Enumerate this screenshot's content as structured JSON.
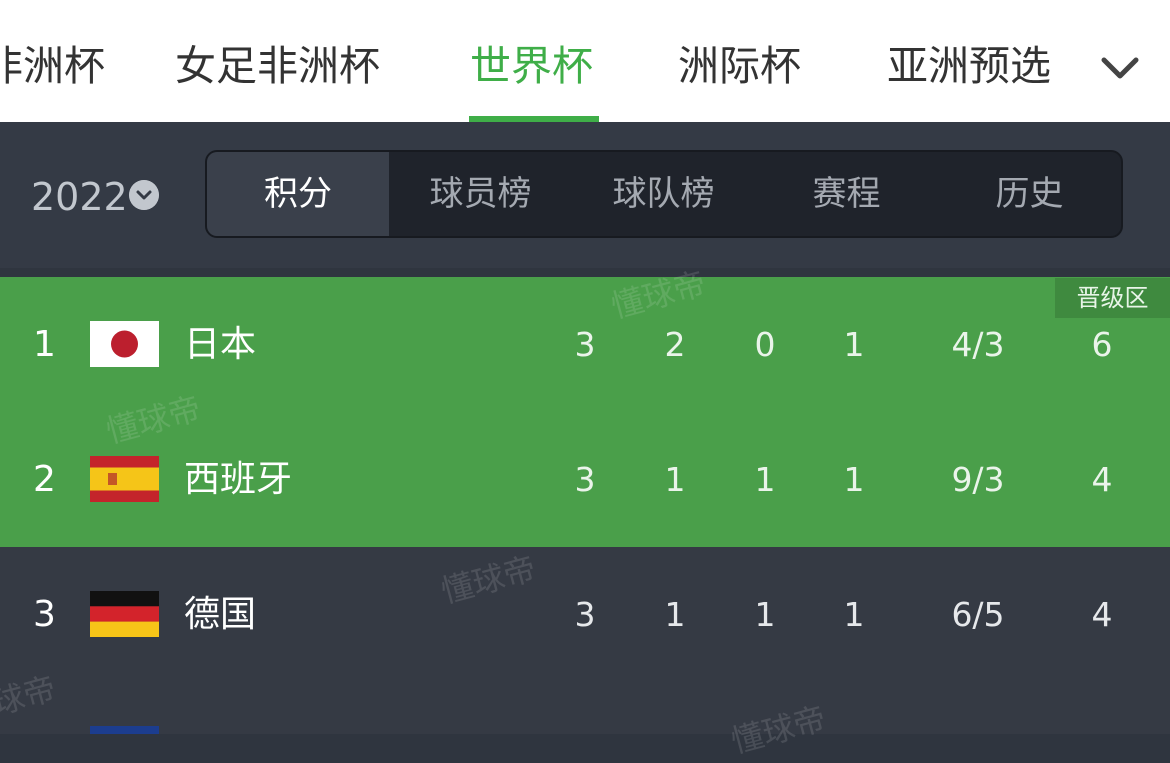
{
  "top_tabs": [
    {
      "label": "非洲杯"
    },
    {
      "label": "女足非洲杯"
    },
    {
      "label": "世界杯"
    },
    {
      "label": "洲际杯"
    },
    {
      "label": "亚洲预选"
    }
  ],
  "active_top_tab": "世界杯",
  "season": {
    "year": "2022"
  },
  "segments": [
    {
      "label": "积分"
    },
    {
      "label": "球员榜"
    },
    {
      "label": "球队榜"
    },
    {
      "label": "赛程"
    },
    {
      "label": "历史"
    }
  ],
  "zone_label": "晋级区",
  "standings": [
    {
      "rank": "1",
      "team": "日本",
      "flag": "japan-flag",
      "played": "3",
      "win": "2",
      "draw": "0",
      "loss": "1",
      "goals": "4/3",
      "points": "6"
    },
    {
      "rank": "2",
      "team": "西班牙",
      "flag": "spain-flag",
      "played": "3",
      "win": "1",
      "draw": "1",
      "loss": "1",
      "goals": "9/3",
      "points": "4"
    },
    {
      "rank": "3",
      "team": "德国",
      "flag": "germany-flag",
      "played": "3",
      "win": "1",
      "draw": "1",
      "loss": "1",
      "goals": "6/5",
      "points": "4"
    }
  ],
  "watermark": "懂球帝",
  "colors": {
    "accent": "#3fae48",
    "qualify_row": "#4a9f4a",
    "dark_bg": "#2f353f"
  }
}
